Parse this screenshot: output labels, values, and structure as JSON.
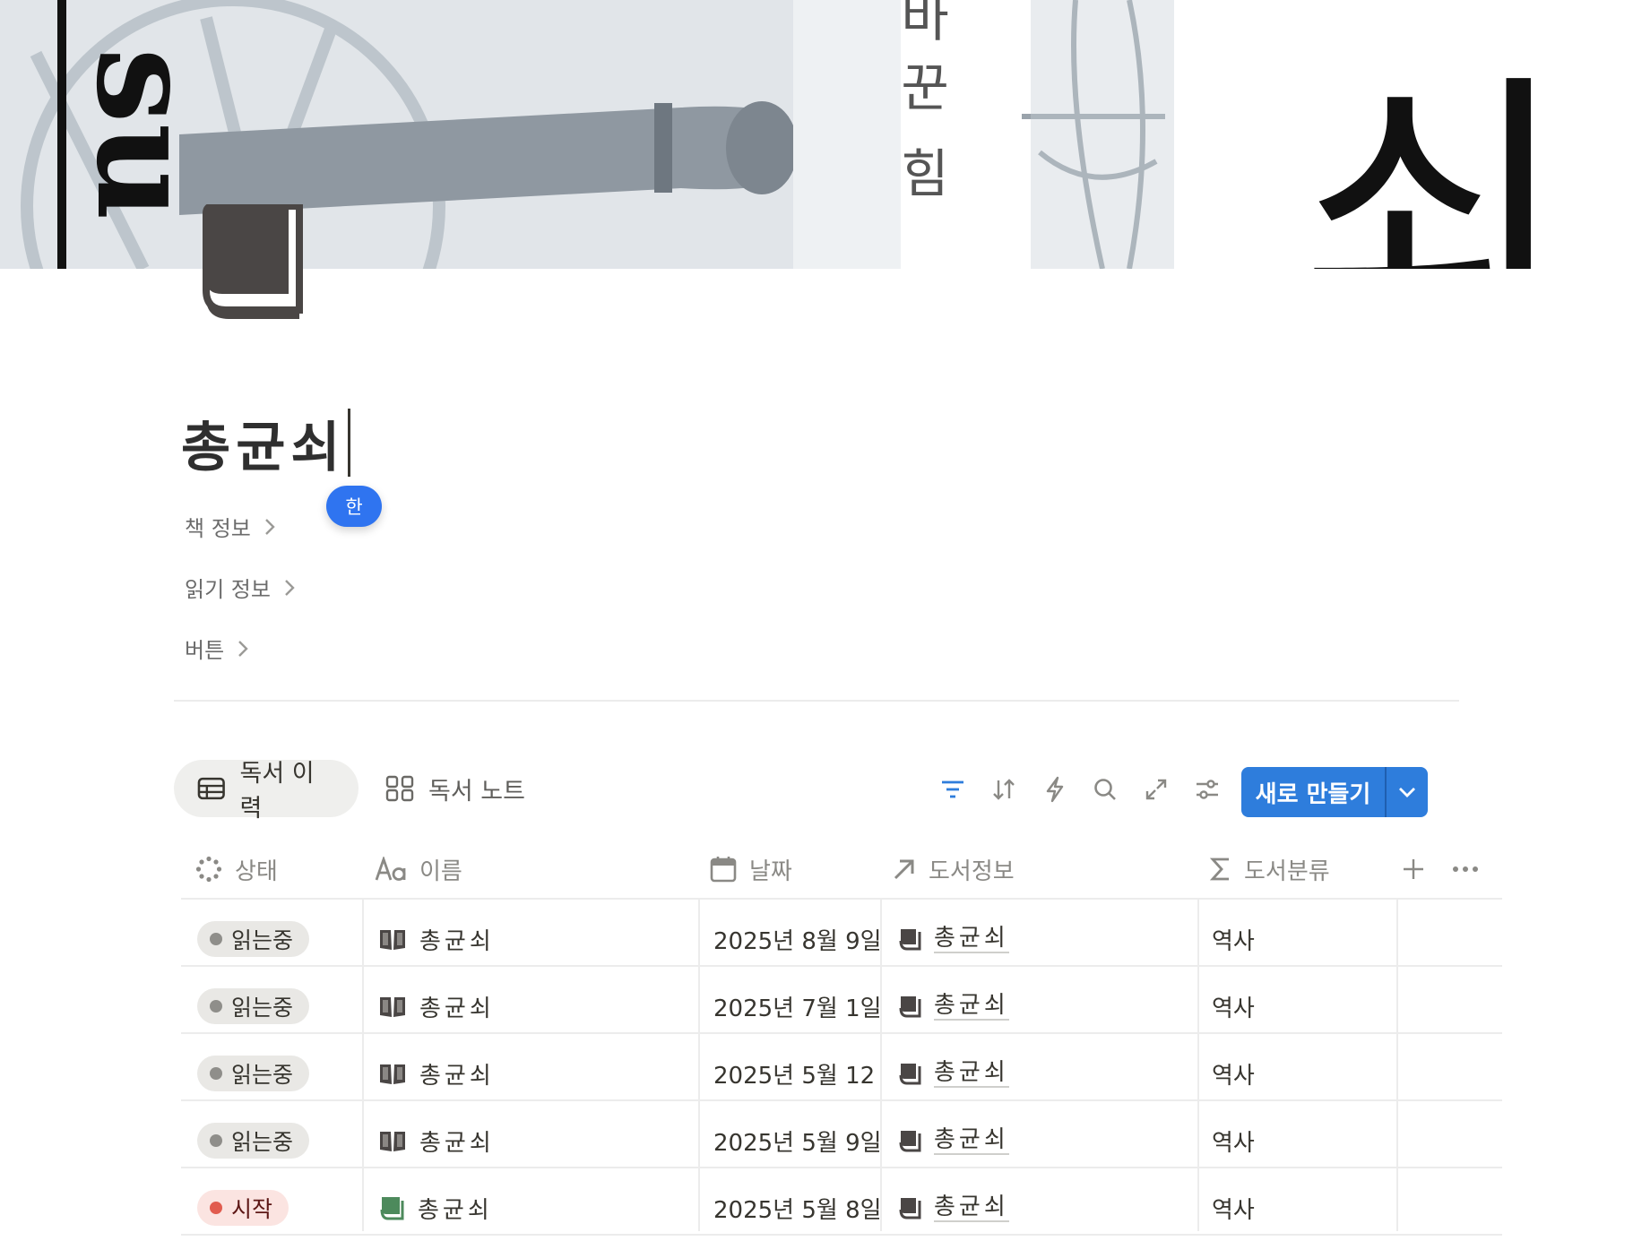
{
  "page": {
    "cover_texts": [
      "su",
      "바",
      "꾼",
      "힘",
      "쇠"
    ],
    "title": "총균쇠",
    "ime_indicator": "한",
    "toggles": [
      {
        "label": "책 정보"
      },
      {
        "label": "읽기 정보"
      },
      {
        "label": "버튼"
      }
    ]
  },
  "database": {
    "views": [
      {
        "label": "독서 이력",
        "icon": "table-icon",
        "active": true
      },
      {
        "label": "독서 노트",
        "icon": "gallery-icon",
        "active": false
      }
    ],
    "toolbar": {
      "icons": [
        "filter-icon",
        "sort-icon",
        "automation-bolt-icon",
        "search-icon",
        "expand-icon",
        "settings-sliders-icon"
      ],
      "new_button_label": "새로 만들기"
    },
    "columns": [
      {
        "label": "상태",
        "icon": "status-loader-icon"
      },
      {
        "label": "이름",
        "icon": "text-aa-icon"
      },
      {
        "label": "날짜",
        "icon": "calendar-icon"
      },
      {
        "label": "도서정보",
        "icon": "relation-arrow-icon"
      },
      {
        "label": "도서분류",
        "icon": "sigma-formula-icon"
      }
    ],
    "rows": [
      {
        "status": "읽는중",
        "status_color": "#8f8e8a",
        "name": "총균쇠",
        "name_icon": "open-book-icon",
        "date": "2025년 8월 9일",
        "book": "총균쇠",
        "category": "역사"
      },
      {
        "status": "읽는중",
        "status_color": "#8f8e8a",
        "name": "총균쇠",
        "name_icon": "open-book-icon",
        "date": "2025년 7월 1일",
        "book": "총균쇠",
        "category": "역사"
      },
      {
        "status": "읽는중",
        "status_color": "#8f8e8a",
        "name": "총균쇠",
        "name_icon": "open-book-icon",
        "date": "2025년 5월 12",
        "book": "총균쇠",
        "category": "역사"
      },
      {
        "status": "읽는중",
        "status_color": "#8f8e8a",
        "name": "총균쇠",
        "name_icon": "open-book-icon",
        "date": "2025년 5월 9일",
        "book": "총균쇠",
        "category": "역사"
      },
      {
        "status": "시작",
        "status_color": "#e15c4f",
        "name": "총균쇠",
        "name_icon": "green-book-icon",
        "date": "2025년 5월 8일",
        "book": "총균쇠",
        "category": "역사"
      }
    ]
  },
  "colors": {
    "accent_blue": "#2e7ddc",
    "tag_reading_bg": "#e9e8e5",
    "tag_start_bg": "#fbe4e1",
    "filter_active": "#2e7ddc"
  }
}
